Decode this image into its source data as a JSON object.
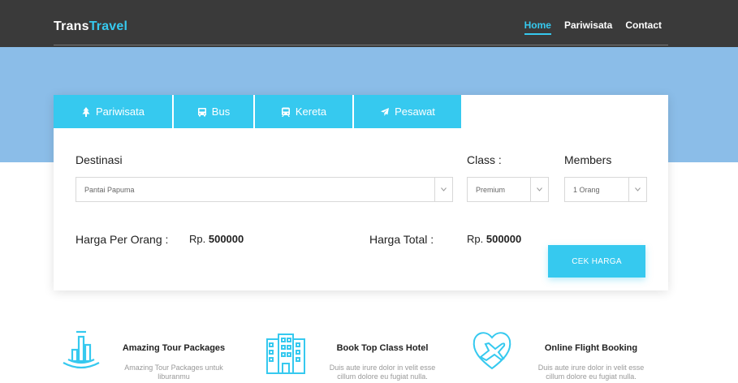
{
  "brand": {
    "part1": "Trans",
    "part2": "Travel"
  },
  "nav": {
    "home": "Home",
    "pariwisata": "Pariwisata",
    "contact": "Contact"
  },
  "tabs": {
    "pariwisata": "Pariwisata",
    "bus": "Bus",
    "kereta": "Kereta",
    "pesawat": "Pesawat"
  },
  "form": {
    "destinasi_label": "Destinasi",
    "destinasi_value": "Pantai Papuma",
    "class_label": "Class :",
    "class_value": "Premium",
    "members_label": "Members",
    "members_value": "1 Orang"
  },
  "pricing": {
    "per_orang_label": "Harga Per Orang :",
    "per_orang_currency": "Rp.",
    "per_orang_amount": "500000",
    "total_label": "Harga Total :",
    "total_currency": "Rp.",
    "total_amount": "500000"
  },
  "button": {
    "cek_harga": "CEK HARGA"
  },
  "features": [
    {
      "title": "Amazing Tour Packages",
      "desc_line1": "Amazing Tour Packages untuk",
      "desc_line2": "liburanmu"
    },
    {
      "title": "Book Top Class Hotel",
      "desc_line1": "Duis aute irure dolor in velit esse",
      "desc_line2": "cillum dolore eu fugiat nulla."
    },
    {
      "title": "Online Flight Booking",
      "desc_line1": "Duis aute irure dolor in velit esse",
      "desc_line2": "cillum dolore eu fugiat nulla."
    }
  ],
  "colors": {
    "accent": "#36c9ef",
    "topbar": "#3a3a3a",
    "hero": "#8bbde8"
  },
  "icons": [
    "tree-icon",
    "bus-icon",
    "train-icon",
    "plane-icon",
    "chevron-down-icon",
    "monument-icon",
    "hotel-icon",
    "flight-heart-icon"
  ]
}
